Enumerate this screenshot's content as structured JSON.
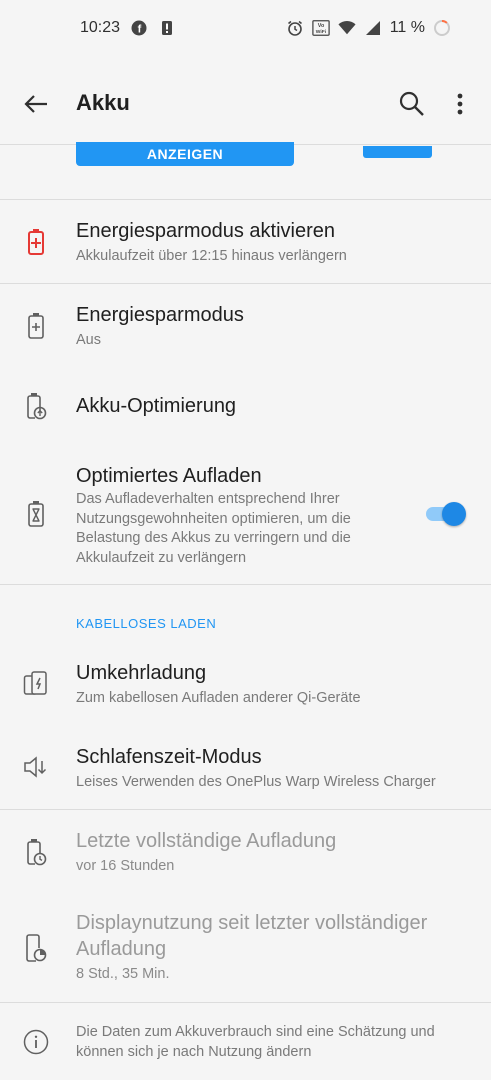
{
  "status_bar": {
    "time": "10:23",
    "battery_percent": "11 %",
    "icons": [
      "facebook-icon",
      "alert-icon",
      "alarm-icon",
      "vowifi-icon",
      "wifi-icon",
      "signal-icon",
      "battery-ring-icon"
    ]
  },
  "app_bar": {
    "title": "Akku"
  },
  "banner": {
    "button_label": "ANZEIGEN"
  },
  "items": [
    {
      "title": "Energiesparmodus aktivieren",
      "subtitle": "Akkulaufzeit über 12:15 hinaus verlängern",
      "icon": "battery-plus-red-icon"
    },
    {
      "title": "Energiesparmodus",
      "subtitle": "Aus",
      "icon": "battery-plus-icon"
    },
    {
      "title": "Akku-Optimierung",
      "subtitle": "",
      "icon": "battery-optimize-icon"
    },
    {
      "title": "Optimiertes Aufladen",
      "subtitle": "Das Aufladeverhalten entsprechend Ihrer Nutzungsgewohnheiten optimieren, um die Belastung des Akkus zu verringern und die Akkulaufzeit zu verlängern",
      "icon": "battery-hourglass-icon",
      "toggle_on": true
    }
  ],
  "section_wireless": {
    "header": "KABELLOSES LADEN",
    "items": [
      {
        "title": "Umkehrladung",
        "subtitle": "Zum kabellosen Aufladen anderer Qi-Geräte",
        "icon": "reverse-charging-icon"
      },
      {
        "title": "Schlafenszeit-Modus",
        "subtitle": "Leises Verwenden des OnePlus Warp Wireless Charger",
        "icon": "speaker-down-icon"
      }
    ]
  },
  "stats": [
    {
      "title": "Letzte vollständige Aufladung",
      "subtitle": "vor 16 Stunden",
      "icon": "battery-clock-icon"
    },
    {
      "title_line1": "Displaynutzung seit letzter vollständiger",
      "title_line2": "Aufladung",
      "subtitle": "8 Std., 35 Min.",
      "icon": "phone-usage-icon"
    }
  ],
  "footer": {
    "text": "Die Daten zum Akkuverbrauch sind eine Schätzung und können sich je nach Nutzung ändern",
    "icon": "info-icon"
  },
  "colors": {
    "accent": "#2196f3",
    "warning_red": "#e53935",
    "background": "#f5f5f5"
  }
}
